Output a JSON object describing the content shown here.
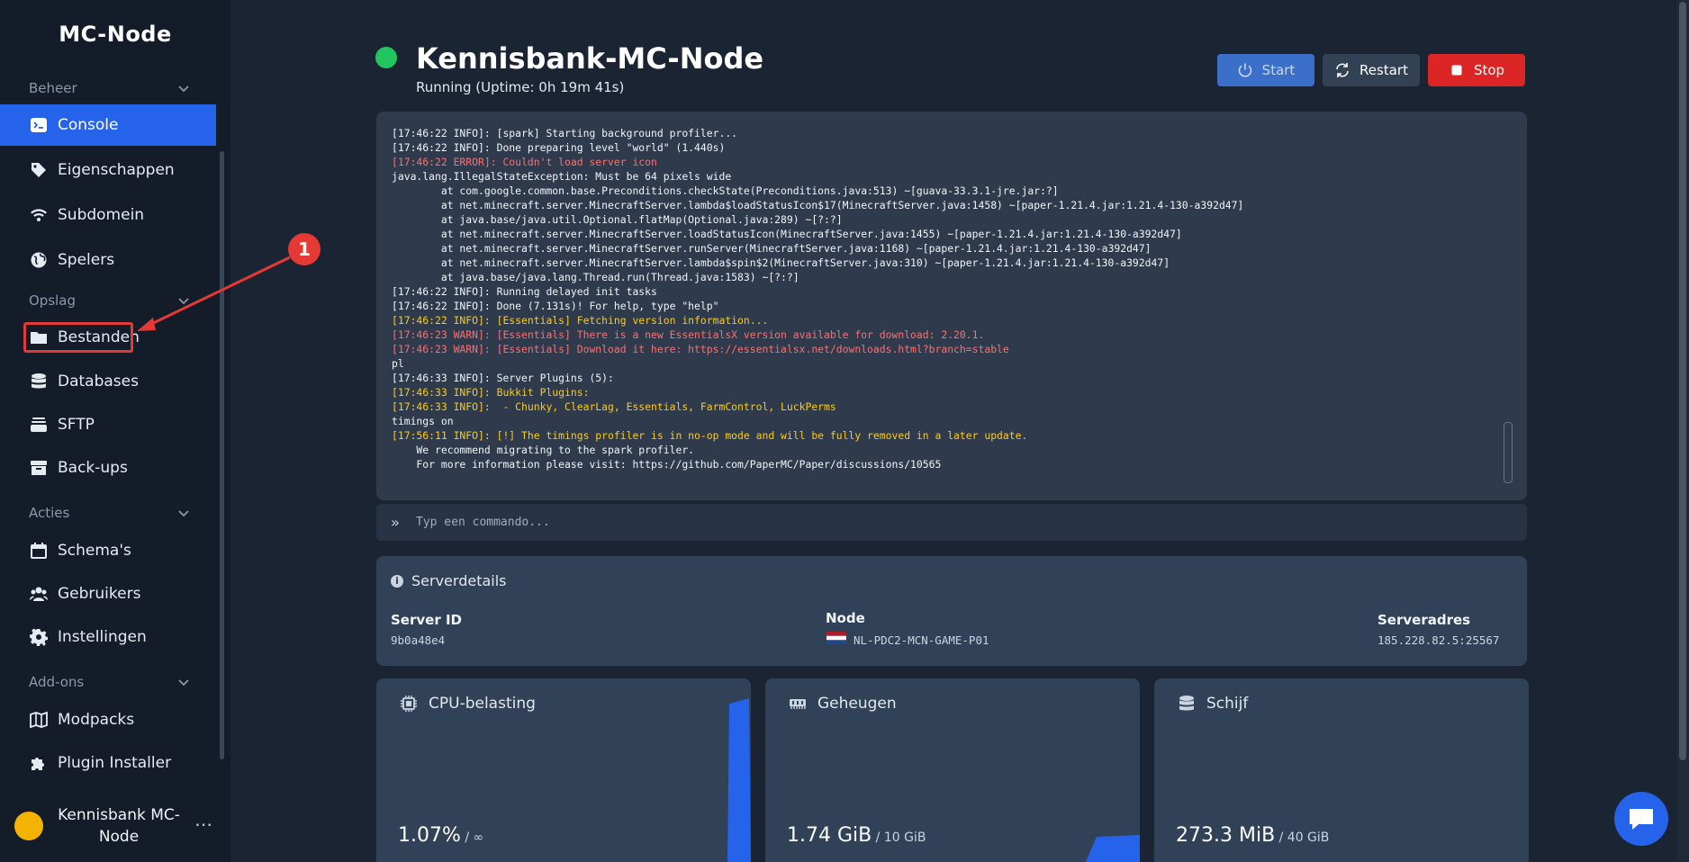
{
  "sidebar": {
    "brand": "MC-Node",
    "sections": {
      "beheer": "Beheer",
      "opslag": "Opslag",
      "acties": "Acties",
      "addons": "Add-ons"
    },
    "items": {
      "console": "Console",
      "eigenschappen": "Eigenschappen",
      "subdomein": "Subdomein",
      "spelers": "Spelers",
      "bestanden": "Bestanden",
      "databases": "Databases",
      "sftp": "SFTP",
      "backups": "Back-ups",
      "schemas": "Schema's",
      "gebruikers": "Gebruikers",
      "instellingen": "Instellingen",
      "modpacks": "Modpacks",
      "plugininstaller": "Plugin Installer"
    },
    "user": {
      "name": "Kennisbank MC-Node",
      "menu": "⋯"
    }
  },
  "header": {
    "title": "Kennisbank-MC-Node",
    "status": "Running (Uptime: 0h 19m 41s)",
    "status_color": "#22c55e",
    "buttons": {
      "start": "Start",
      "restart": "Restart",
      "stop": "Stop"
    }
  },
  "console": {
    "lines": [
      {
        "t": "[17:46:22 INFO]: [spark] Starting background profiler...",
        "c": ""
      },
      {
        "t": "[17:46:22 INFO]: Done preparing level \"world\" (1.440s)",
        "c": ""
      },
      {
        "t": "[17:46:22 ERROR]: Couldn't load server icon",
        "c": "red"
      },
      {
        "t": "java.lang.IllegalStateException: Must be 64 pixels wide",
        "c": ""
      },
      {
        "t": "        at com.google.common.base.Preconditions.checkState(Preconditions.java:513) ~[guava-33.3.1-jre.jar:?]",
        "c": ""
      },
      {
        "t": "        at net.minecraft.server.MinecraftServer.lambda$loadStatusIcon$17(MinecraftServer.java:1458) ~[paper-1.21.4.jar:1.21.4-130-a392d47]",
        "c": ""
      },
      {
        "t": "        at java.base/java.util.Optional.flatMap(Optional.java:289) ~[?:?]",
        "c": ""
      },
      {
        "t": "        at net.minecraft.server.MinecraftServer.loadStatusIcon(MinecraftServer.java:1455) ~[paper-1.21.4.jar:1.21.4-130-a392d47]",
        "c": ""
      },
      {
        "t": "        at net.minecraft.server.MinecraftServer.runServer(MinecraftServer.java:1168) ~[paper-1.21.4.jar:1.21.4-130-a392d47]",
        "c": ""
      },
      {
        "t": "        at net.minecraft.server.MinecraftServer.lambda$spin$2(MinecraftServer.java:310) ~[paper-1.21.4.jar:1.21.4-130-a392d47]",
        "c": ""
      },
      {
        "t": "        at java.base/java.lang.Thread.run(Thread.java:1583) ~[?:?]",
        "c": ""
      },
      {
        "t": "[17:46:22 INFO]: Running delayed init tasks",
        "c": ""
      },
      {
        "t": "[17:46:22 INFO]: Done (7.131s)! For help, type \"help\"",
        "c": ""
      },
      {
        "t": "[17:46:22 INFO]: [Essentials] Fetching version information...",
        "c": "yel"
      },
      {
        "t": "[17:46:23 WARN]: [Essentials] There is a new EssentialsX version available for download: 2.20.1.",
        "c": "warnred"
      },
      {
        "t": "[17:46:23 WARN]: [Essentials] Download it here: https://essentialsx.net/downloads.html?branch=stable",
        "c": "warnred"
      },
      {
        "t": "pl",
        "c": ""
      },
      {
        "t": "[17:46:33 INFO]: Server Plugins (5):",
        "c": ""
      },
      {
        "t": "[17:46:33 INFO]: Bukkit Plugins:",
        "c": "yel"
      },
      {
        "t": "[17:46:33 INFO]:  - Chunky, ClearLag, Essentials, FarmControl, LuckPerms",
        "c": "yel"
      },
      {
        "t": "timings on",
        "c": ""
      },
      {
        "t": "[17:56:11 INFO]: [!] The timings profiler is in no-op mode and will be fully removed in a later update.",
        "c": "yel"
      },
      {
        "t": "    We recommend migrating to the spark profiler.",
        "c": ""
      },
      {
        "t": "    For more information please visit: https://github.com/PaperMC/Paper/discussions/10565",
        "c": ""
      }
    ],
    "command_placeholder": "Typ een commando...",
    "command_prompt": "»"
  },
  "details": {
    "heading": "Serverdetails",
    "server_id_label": "Server ID",
    "server_id": "9b0a48e4",
    "node_label": "Node",
    "node": "NL-PDC2-MCN-GAME-P01",
    "address_label": "Serveradres",
    "address": "185.228.82.5:25567"
  },
  "stats": {
    "cpu": {
      "label": "CPU-belasting",
      "value": "1.07%",
      "limit": " / ∞"
    },
    "memory": {
      "label": "Geheugen",
      "value": "1.74 GiB",
      "limit": " / 10 GiB"
    },
    "disk": {
      "label": "Schijf",
      "value": "273.3 MiB",
      "limit": " / 40 GiB"
    }
  },
  "annotation": {
    "badge": "1"
  },
  "colors": {
    "accent": "#2563eb",
    "stop": "#dc2626",
    "error": "#f87171",
    "warning": "#facc15"
  }
}
